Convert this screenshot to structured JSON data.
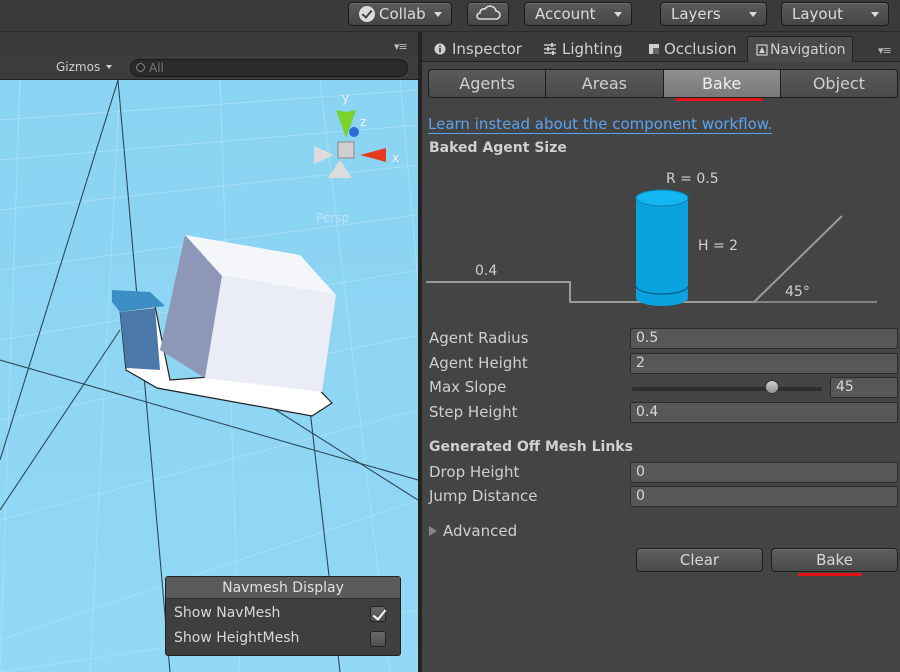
{
  "toolbar": {
    "collab": "Collab",
    "account": "Account",
    "layers": "Layers",
    "layout": "Layout"
  },
  "scene": {
    "gizmos": "Gizmos",
    "search_placeholder": "All",
    "gizmo_axes": {
      "y": "y",
      "z": "z",
      "x": "x"
    },
    "persp": "Persp"
  },
  "navmesh_display": {
    "title": "Navmesh Display",
    "show_navmesh": {
      "label": "Show NavMesh",
      "checked": true
    },
    "show_heightmesh": {
      "label": "Show HeightMesh",
      "checked": false
    }
  },
  "window_tabs": [
    "Inspector",
    "Lighting",
    "Occlusion",
    "Navigation"
  ],
  "nav_tabs": {
    "items": [
      "Agents",
      "Areas",
      "Bake",
      "Object"
    ],
    "selected": "Bake"
  },
  "link_text": "Learn instead about the component workflow.",
  "baked_agent_size": {
    "title": "Baked Agent Size",
    "radius_label": "R = 0.5",
    "height_label": "H = 2",
    "step_label": "0.4",
    "slope_label": "45°"
  },
  "fields": {
    "agent_radius": {
      "label": "Agent Radius",
      "value": "0.5"
    },
    "agent_height": {
      "label": "Agent Height",
      "value": "2"
    },
    "max_slope": {
      "label": "Max Slope",
      "value": "45"
    },
    "step_height": {
      "label": "Step Height",
      "value": "0.4"
    }
  },
  "off_mesh": {
    "title": "Generated Off Mesh Links",
    "drop_height": {
      "label": "Drop Height",
      "value": "0"
    },
    "jump_distance": {
      "label": "Jump Distance",
      "value": "0"
    }
  },
  "advanced": "Advanced",
  "buttons": {
    "clear": "Clear",
    "bake": "Bake"
  },
  "colors": {
    "accent_red": "#e0141a",
    "link_blue": "#5ca3ef",
    "cylinder_blue": "#0aa3e0"
  }
}
